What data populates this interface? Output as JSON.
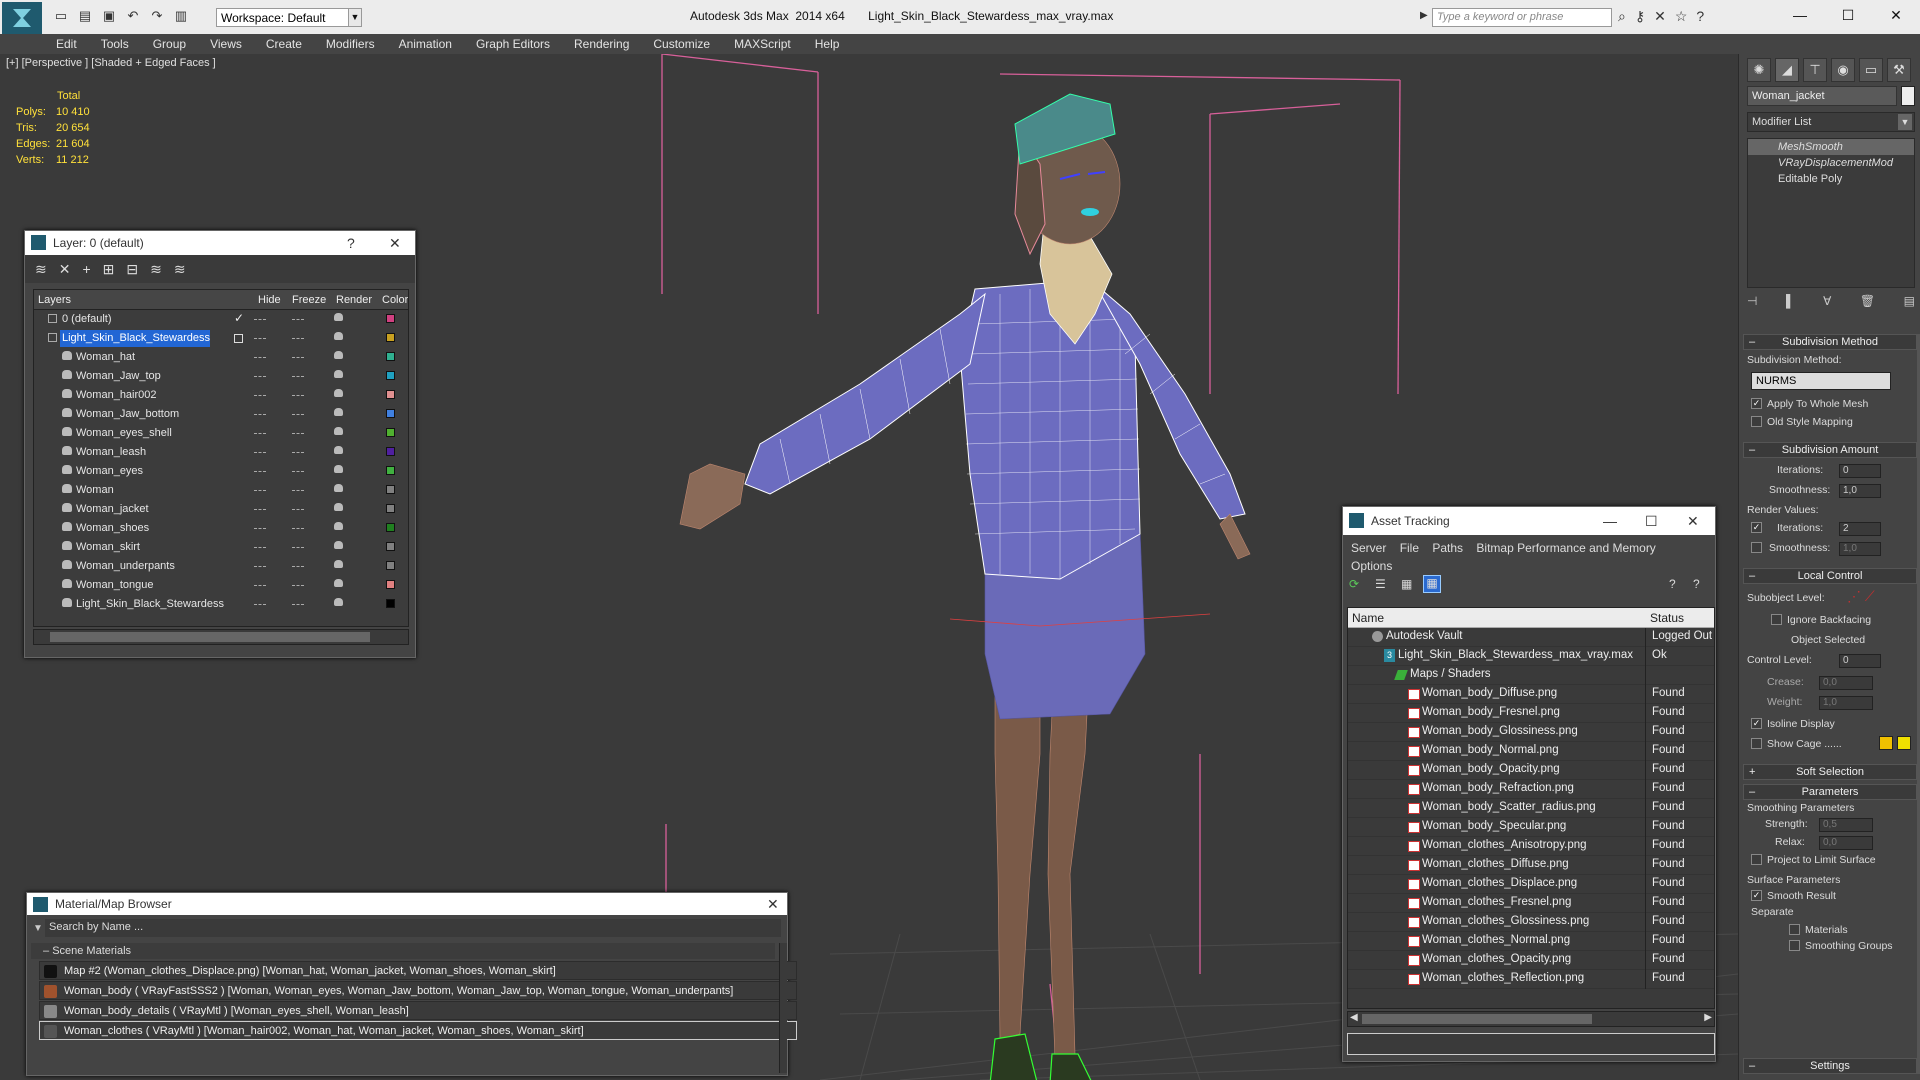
{
  "titlebar": {
    "workspace": "Workspace: Default",
    "app_title": "Autodesk 3ds Max  2014 x64       Light_Skin_Black_Stewardess_max_vray.max",
    "search_placeholder": "Type a keyword or phrase"
  },
  "menu": [
    "Edit",
    "Tools",
    "Group",
    "Views",
    "Create",
    "Modifiers",
    "Animation",
    "Graph Editors",
    "Rendering",
    "Customize",
    "MAXScript",
    "Help"
  ],
  "viewport": {
    "label": "[+] [Perspective ] [Shaded + Edged Faces ]",
    "stats": {
      "header": "Total",
      "rows": [
        {
          "k": "Polys:",
          "v": "10 410"
        },
        {
          "k": "Tris:",
          "v": "20 654"
        },
        {
          "k": "Edges:",
          "v": "21 604"
        },
        {
          "k": "Verts:",
          "v": "11 212"
        }
      ]
    }
  },
  "command_panel": {
    "object_name": "Woman_jacket",
    "modifier_list": "Modifier List",
    "stack": [
      "MeshSmooth",
      "VRayDisplacementMod",
      "Editable Poly"
    ],
    "subdivision_method": {
      "title": "Subdivision Method",
      "label": "Subdivision Method:",
      "value": "NURMS",
      "apply_whole_mesh": "Apply To Whole Mesh",
      "old_style": "Old Style Mapping"
    },
    "subdivision_amount": {
      "title": "Subdivision Amount",
      "iterations_label": "Iterations:",
      "iterations": "0",
      "smoothness_label": "Smoothness:",
      "smoothness": "1,0",
      "render_values": "Render Values:",
      "r_iterations_label": "Iterations:",
      "r_iterations": "2",
      "r_smoothness_label": "Smoothness:",
      "r_smoothness": "1,0"
    },
    "local_control": {
      "title": "Local Control",
      "subobject_level": "Subobject Level:",
      "ignore_backfacing": "Ignore Backfacing",
      "object_selected": "Object Selected",
      "control_level_label": "Control Level:",
      "control_level": "0",
      "crease_label": "Crease:",
      "crease": "0,0",
      "weight_label": "Weight:",
      "weight": "1,0",
      "isoline": "Isoline Display",
      "show_cage": "Show Cage ......",
      "cage_color1": "#f0c000",
      "cage_color2": "#f0e000"
    },
    "soft_selection": "Soft Selection",
    "parameters": {
      "title": "Parameters",
      "smoothing_params": "Smoothing Parameters",
      "strength_label": "Strength:",
      "strength": "0,5",
      "relax_label": "Relax:",
      "relax": "0,0",
      "project": "Project to Limit Surface",
      "surface_params": "Surface Parameters",
      "smooth_result": "Smooth Result",
      "separate": "Separate",
      "materials": "Materials",
      "smoothing_groups": "Smoothing Groups"
    },
    "settings": "Settings"
  },
  "layer_window": {
    "title": "Layer: 0 (default)",
    "columns": {
      "layers": "Layers",
      "hide": "Hide",
      "freeze": "Freeze",
      "render": "Render",
      "color": "Color"
    },
    "rows": [
      {
        "name": "0 (default)",
        "indent": 1,
        "color": "#d04080",
        "type": "layer",
        "check": "✓"
      },
      {
        "name": "Light_Skin_Black_Stewardess",
        "indent": 1,
        "color": "#c8a020",
        "type": "layer",
        "selected": true
      },
      {
        "name": "Woman_hat",
        "indent": 2,
        "color": "#30b090",
        "type": "obj"
      },
      {
        "name": "Woman_Jaw_top",
        "indent": 2,
        "color": "#20a0c0",
        "type": "obj"
      },
      {
        "name": "Woman_hair002",
        "indent": 2,
        "color": "#e09090",
        "type": "obj"
      },
      {
        "name": "Woman_Jaw_bottom",
        "indent": 2,
        "color": "#4080e0",
        "type": "obj"
      },
      {
        "name": "Woman_eyes_shell",
        "indent": 2,
        "color": "#50b030",
        "type": "obj"
      },
      {
        "name": "Woman_leash",
        "indent": 2,
        "color": "#5020a0",
        "type": "obj"
      },
      {
        "name": "Woman_eyes",
        "indent": 2,
        "color": "#40b040",
        "type": "obj"
      },
      {
        "name": "Woman",
        "indent": 2,
        "color": "#808080",
        "type": "obj"
      },
      {
        "name": "Woman_jacket",
        "indent": 2,
        "color": "#808080",
        "type": "obj"
      },
      {
        "name": "Woman_shoes",
        "indent": 2,
        "color": "#208020",
        "type": "obj"
      },
      {
        "name": "Woman_skirt",
        "indent": 2,
        "color": "#808080",
        "type": "obj"
      },
      {
        "name": "Woman_underpants",
        "indent": 2,
        "color": "#808080",
        "type": "obj"
      },
      {
        "name": "Woman_tongue",
        "indent": 2,
        "color": "#e08080",
        "type": "obj"
      },
      {
        "name": "Light_Skin_Black_Stewardess",
        "indent": 2,
        "color": "#000000",
        "type": "obj"
      }
    ]
  },
  "material_browser": {
    "title": "Material/Map Browser",
    "search": "Search by Name ...",
    "group": "Scene Materials",
    "items": [
      {
        "label": "Map #2 (Woman_clothes_Displace.png)  [Woman_hat, Woman_jacket, Woman_shoes, Woman_skirt]",
        "icon": "#111"
      },
      {
        "label": "Woman_body  ( VRayFastSSS2 )  [Woman, Woman_eyes, Woman_Jaw_bottom, Woman_Jaw_top, Woman_tongue, Woman_underpants]",
        "icon": "#a0522d"
      },
      {
        "label": "Woman_body_details  ( VRayMtl )  [Woman_eyes_shell, Woman_leash]",
        "icon": "#888"
      },
      {
        "label": "Woman_clothes  ( VRayMtl )  [Woman_hair002, Woman_hat, Woman_jacket, Woman_shoes, Woman_skirt]",
        "icon": "#555",
        "selected": true
      }
    ]
  },
  "asset_tracking": {
    "title": "Asset Tracking",
    "menu_row1": [
      "Server",
      "File",
      "Paths",
      "Bitmap Performance and Memory"
    ],
    "menu_row2": [
      "Options"
    ],
    "col_name": "Name",
    "col_status": "Status",
    "rows": [
      {
        "name": "Autodesk Vault",
        "status": "Logged Out",
        "indent": 24,
        "kind": "vault"
      },
      {
        "name": "Light_Skin_Black_Stewardess_max_vray.max",
        "status": "Ok",
        "indent": 36,
        "kind": "max"
      },
      {
        "name": "Maps / Shaders",
        "status": "",
        "indent": 48,
        "kind": "folder"
      },
      {
        "name": "Woman_body_Diffuse.png",
        "status": "Found",
        "indent": 60,
        "kind": "png"
      },
      {
        "name": "Woman_body_Fresnel.png",
        "status": "Found",
        "indent": 60,
        "kind": "png"
      },
      {
        "name": "Woman_body_Glossiness.png",
        "status": "Found",
        "indent": 60,
        "kind": "png"
      },
      {
        "name": "Woman_body_Normal.png",
        "status": "Found",
        "indent": 60,
        "kind": "png"
      },
      {
        "name": "Woman_body_Opacity.png",
        "status": "Found",
        "indent": 60,
        "kind": "png"
      },
      {
        "name": "Woman_body_Refraction.png",
        "status": "Found",
        "indent": 60,
        "kind": "png"
      },
      {
        "name": "Woman_body_Scatter_radius.png",
        "status": "Found",
        "indent": 60,
        "kind": "png"
      },
      {
        "name": "Woman_body_Specular.png",
        "status": "Found",
        "indent": 60,
        "kind": "png"
      },
      {
        "name": "Woman_clothes_Anisotropy.png",
        "status": "Found",
        "indent": 60,
        "kind": "png"
      },
      {
        "name": "Woman_clothes_Diffuse.png",
        "status": "Found",
        "indent": 60,
        "kind": "png"
      },
      {
        "name": "Woman_clothes_Displace.png",
        "status": "Found",
        "indent": 60,
        "kind": "png"
      },
      {
        "name": "Woman_clothes_Fresnel.png",
        "status": "Found",
        "indent": 60,
        "kind": "png"
      },
      {
        "name": "Woman_clothes_Glossiness.png",
        "status": "Found",
        "indent": 60,
        "kind": "png"
      },
      {
        "name": "Woman_clothes_Normal.png",
        "status": "Found",
        "indent": 60,
        "kind": "png"
      },
      {
        "name": "Woman_clothes_Opacity.png",
        "status": "Found",
        "indent": 60,
        "kind": "png"
      },
      {
        "name": "Woman_clothes_Reflection.png",
        "status": "Found",
        "indent": 60,
        "kind": "png"
      }
    ]
  }
}
